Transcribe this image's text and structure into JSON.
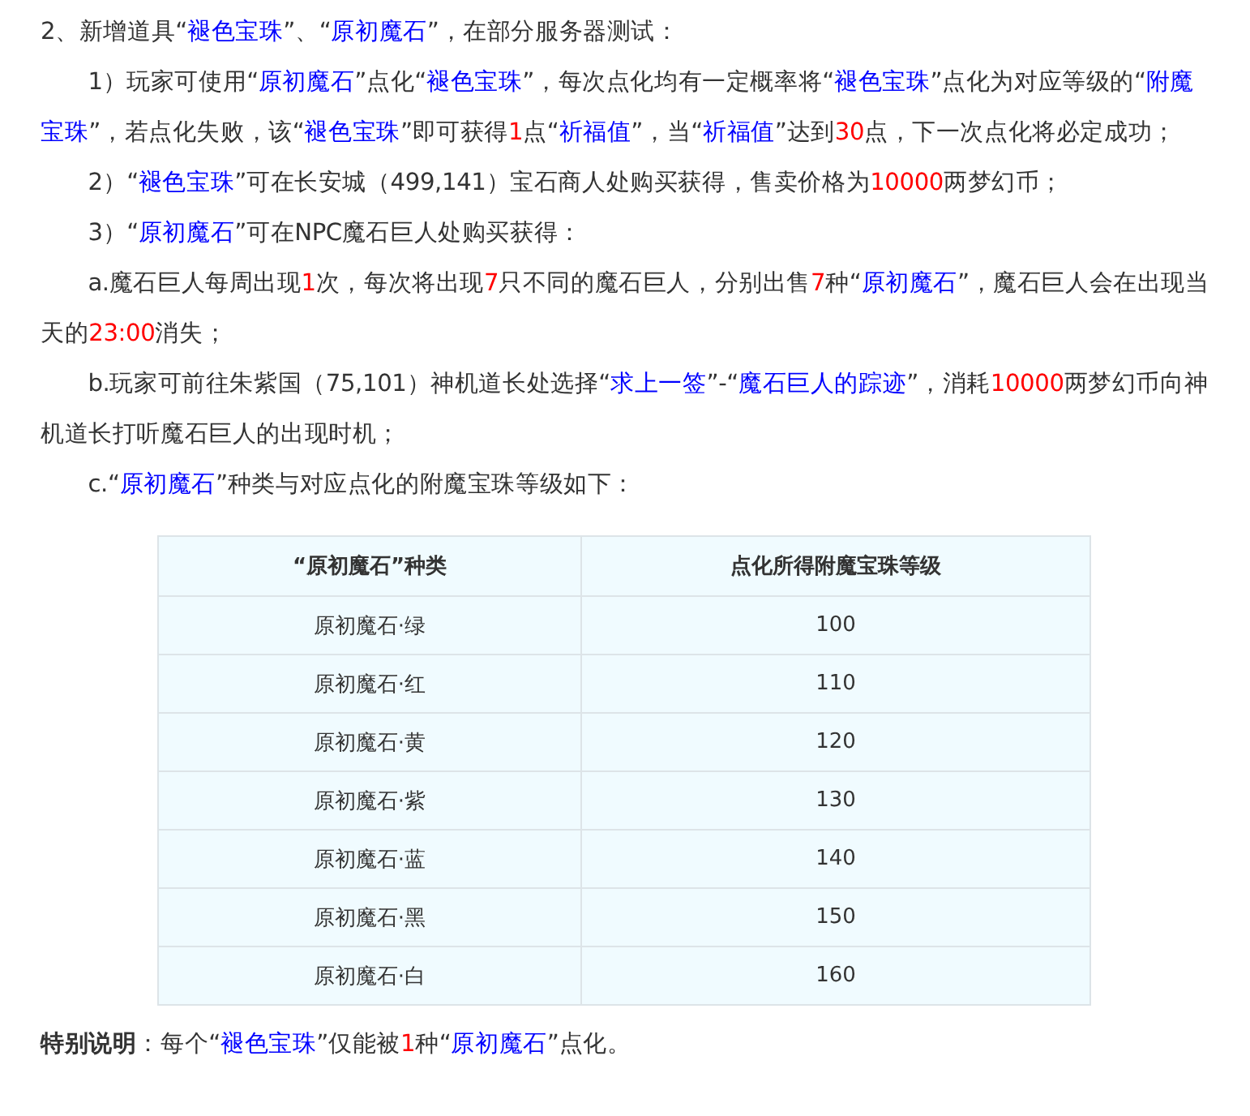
{
  "paragraphs": [
    {
      "indent": false,
      "segments": [
        {
          "kind": "plain",
          "text": "2、新增道具“"
        },
        {
          "kind": "term",
          "text": "褪色宝珠"
        },
        {
          "kind": "plain",
          "text": "”、“"
        },
        {
          "kind": "term",
          "text": "原初魔石"
        },
        {
          "kind": "plain",
          "text": "”，在部分服务器测试："
        }
      ]
    },
    {
      "indent": true,
      "segments": [
        {
          "kind": "plain",
          "text": "1）玩家可使用“"
        },
        {
          "kind": "term",
          "text": "原初魔石"
        },
        {
          "kind": "plain",
          "text": "”点化“"
        },
        {
          "kind": "term",
          "text": "褪色宝珠"
        },
        {
          "kind": "plain",
          "text": "”，每次点化均有一定概率将“"
        },
        {
          "kind": "term",
          "text": "褪色宝珠"
        },
        {
          "kind": "plain",
          "text": "”点化为对应等级的“"
        },
        {
          "kind": "term",
          "text": "附魔宝珠"
        },
        {
          "kind": "plain",
          "text": "”，若点化失败，该“"
        },
        {
          "kind": "term",
          "text": "褪色宝珠"
        },
        {
          "kind": "plain",
          "text": "”即可获得"
        },
        {
          "kind": "number",
          "text": "1"
        },
        {
          "kind": "plain",
          "text": "点“"
        },
        {
          "kind": "term",
          "text": "祈福值"
        },
        {
          "kind": "plain",
          "text": "”，当“"
        },
        {
          "kind": "term",
          "text": "祈福值"
        },
        {
          "kind": "plain",
          "text": "”达到"
        },
        {
          "kind": "number",
          "text": "30"
        },
        {
          "kind": "plain",
          "text": "点，下一次点化将必定成功；"
        }
      ]
    },
    {
      "indent": true,
      "segments": [
        {
          "kind": "plain",
          "text": "2）“"
        },
        {
          "kind": "term",
          "text": "褪色宝珠"
        },
        {
          "kind": "plain",
          "text": "”可在长安城（499,141）宝石商人处购买获得，售卖价格为"
        },
        {
          "kind": "number",
          "text": "10000"
        },
        {
          "kind": "plain",
          "text": "两梦幻币；"
        }
      ]
    },
    {
      "indent": true,
      "segments": [
        {
          "kind": "plain",
          "text": "3）“"
        },
        {
          "kind": "term",
          "text": "原初魔石"
        },
        {
          "kind": "plain",
          "text": "”可在NPC魔石巨人处购买获得："
        }
      ]
    },
    {
      "indent": true,
      "segments": [
        {
          "kind": "plain",
          "text": "a.魔石巨人每周出现"
        },
        {
          "kind": "number",
          "text": "1"
        },
        {
          "kind": "plain",
          "text": "次，每次将出现"
        },
        {
          "kind": "number",
          "text": "7"
        },
        {
          "kind": "plain",
          "text": "只不同的魔石巨人，分别出售"
        },
        {
          "kind": "number",
          "text": "7"
        },
        {
          "kind": "plain",
          "text": "种“"
        },
        {
          "kind": "term",
          "text": "原初魔石"
        },
        {
          "kind": "plain",
          "text": "”，魔石巨人会在出现当天的"
        },
        {
          "kind": "number",
          "text": "23:00"
        },
        {
          "kind": "plain",
          "text": "消失；"
        }
      ]
    },
    {
      "indent": true,
      "segments": [
        {
          "kind": "plain",
          "text": "b.玩家可前往朱紫国（75,101）神机道长处选择“"
        },
        {
          "kind": "term",
          "text": "求上一签"
        },
        {
          "kind": "plain",
          "text": "”-“"
        },
        {
          "kind": "term",
          "text": "魔石巨人的踪迹"
        },
        {
          "kind": "plain",
          "text": "”，消耗"
        },
        {
          "kind": "number",
          "text": "10000"
        },
        {
          "kind": "plain",
          "text": "两梦幻币向神机道长打听魔石巨人的出现时机；"
        }
      ]
    },
    {
      "indent": true,
      "segments": [
        {
          "kind": "plain",
          "text": "c.“"
        },
        {
          "kind": "term",
          "text": "原初魔石"
        },
        {
          "kind": "plain",
          "text": "”种类与对应点化的附魔宝珠等级如下："
        }
      ]
    }
  ],
  "table": {
    "columns": [
      "“原初魔石”种类",
      "点化所得附魔宝珠等级"
    ],
    "rows": [
      [
        "原初魔石·绿",
        "100"
      ],
      [
        "原初魔石·红",
        "110"
      ],
      [
        "原初魔石·黄",
        "120"
      ],
      [
        "原初魔石·紫",
        "130"
      ],
      [
        "原初魔石·蓝",
        "140"
      ],
      [
        "原初魔石·黑",
        "150"
      ],
      [
        "原初魔石·白",
        "160"
      ]
    ]
  },
  "note": {
    "segments": [
      {
        "kind": "bold",
        "text": "特别说明"
      },
      {
        "kind": "plain",
        "text": "：每个“"
      },
      {
        "kind": "term",
        "text": "褪色宝珠"
      },
      {
        "kind": "plain",
        "text": "”仅能被"
      },
      {
        "kind": "number",
        "text": "1"
      },
      {
        "kind": "plain",
        "text": "种“"
      },
      {
        "kind": "term",
        "text": "原初魔石"
      },
      {
        "kind": "plain",
        "text": "”点化。"
      }
    ]
  }
}
